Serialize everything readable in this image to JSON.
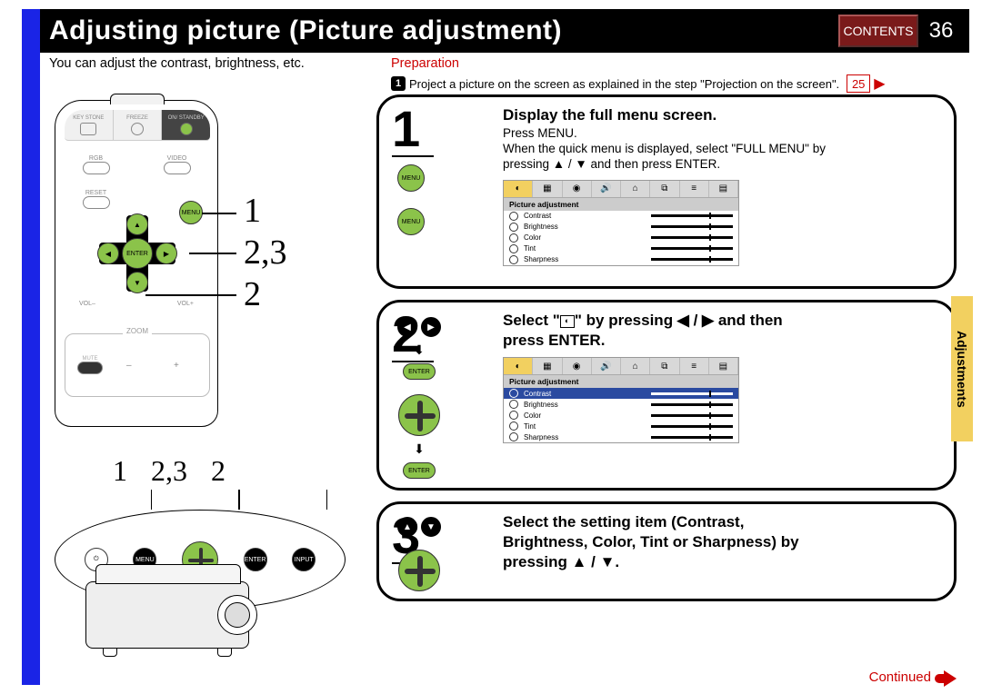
{
  "title": "Adjusting picture (Picture adjustment)",
  "contents_label": "CONTENTS",
  "page_number": "36",
  "intro_text": "You can adjust the contrast, brightness, etc.",
  "side_tab": "Adjustments",
  "preparation": {
    "label": "Preparation",
    "bullet_num": "1",
    "text": "Project a picture on the screen as explained in the step \"Projection on the screen\".",
    "ref_page": "25"
  },
  "remote": {
    "keystone": "KEY STONE",
    "standby": "ON/ STANDBY",
    "freeze": "FREEZE",
    "rgb": "RGB",
    "video": "VIDEO",
    "reset": "RESET",
    "menu": "MENU",
    "enter": "ENTER",
    "vol_minus": "VOL–",
    "vol_plus": "VOL+",
    "zoom": "ZOOM",
    "mute": "MUTE",
    "annot1": "1",
    "annot23": "2,3",
    "annot2": "2"
  },
  "panel": {
    "n1": "1",
    "n23": "2,3",
    "n2": "2",
    "menu": "MENU",
    "enter": "ENTER",
    "input": "INPUT"
  },
  "step1": {
    "num": "1",
    "title": "Display the full menu screen.",
    "line1": "Press MENU.",
    "line2a": "When the quick menu is displayed, select \"FULL MENU\" by",
    "line2b": "pressing ▲ / ▼ and then press ENTER.",
    "icon_menu": "MENU",
    "menu": {
      "header": "Picture adjustment",
      "items": [
        "Contrast",
        "Brightness",
        "Color",
        "Tint",
        "Sharpness"
      ]
    }
  },
  "step2": {
    "num": "2",
    "title_a": "Select \"",
    "title_b": "\" by pressing ◀ / ▶ and then",
    "title_c": "press ENTER.",
    "icon_enter": "ENTER",
    "menu": {
      "header": "Picture adjustment",
      "items": [
        "Contrast",
        "Brightness",
        "Color",
        "Tint",
        "Sharpness"
      ]
    }
  },
  "step3": {
    "num": "3",
    "title_a": "Select the setting item (Contrast,",
    "title_b": "Brightness, Color, Tint or Sharpness) by",
    "title_c": "pressing ▲ / ▼."
  },
  "continued": "Continued"
}
